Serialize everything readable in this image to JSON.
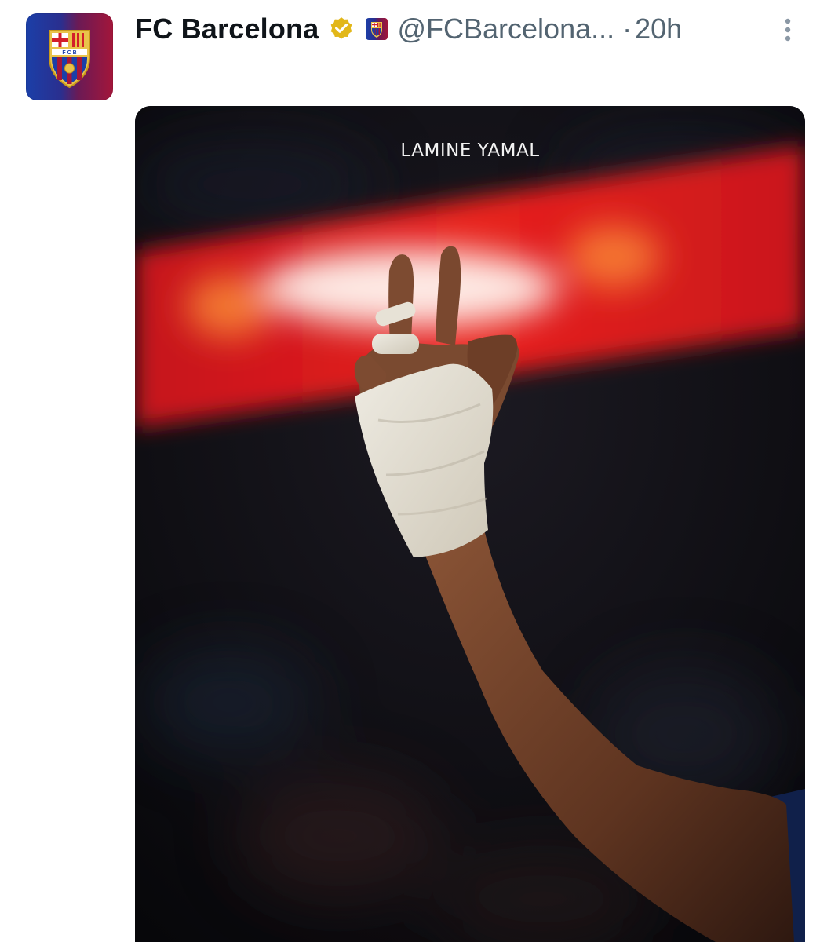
{
  "tweet": {
    "author": {
      "display_name": "FC Barcelona",
      "handle": "@FCBarcelona...",
      "verified_icon": "gold-verified-badge-icon",
      "affiliate_icon": "fcb-crest-icon"
    },
    "separator": "·",
    "timestamp": "20h",
    "more_icon": "vertical-ellipsis-icon",
    "media": {
      "caption": "LAMINE YAMAL",
      "description_icon": "raised-bandaged-hand-photo"
    }
  },
  "colors": {
    "text_primary": "#0f1419",
    "text_secondary": "#536471",
    "verified_gold": "#e2b719",
    "barca_blue": "#1b3fa8",
    "barca_red": "#a3163a"
  }
}
